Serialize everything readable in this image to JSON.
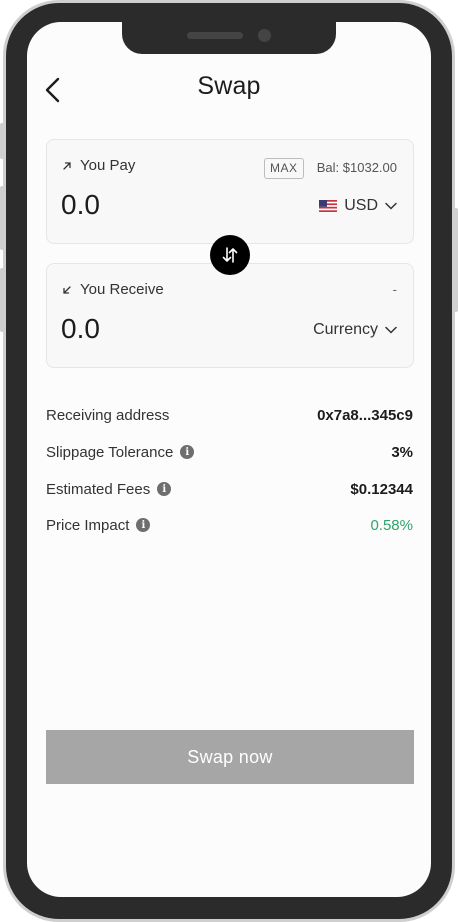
{
  "header": {
    "title": "Swap",
    "back_icon": "chevron-left-icon"
  },
  "pay": {
    "label": "You Pay",
    "amount": "0.0",
    "max_label": "MAX",
    "balance": "Bal: $1032.00",
    "currency": "USD",
    "icon": "arrow-up-right-icon"
  },
  "receive": {
    "label": "You Receive",
    "amount": "0.0",
    "balance": "-",
    "currency": "Currency",
    "icon": "arrow-down-left-icon"
  },
  "details": [
    {
      "label": "Receiving address",
      "value": "0x7a8...345c9"
    },
    {
      "label": "Slippage Tolerance",
      "value": "3%"
    },
    {
      "label": "Estimated Fees",
      "value": "$0.12344"
    },
    {
      "label": "Price Impact",
      "value": "0.58%"
    }
  ],
  "info_icon_glyph": "i",
  "swap_button": {
    "label": "Swap now"
  },
  "colors": {
    "positive": "#2fa36b",
    "button_disabled": "#a6a6a6",
    "toggle": "#000000"
  }
}
